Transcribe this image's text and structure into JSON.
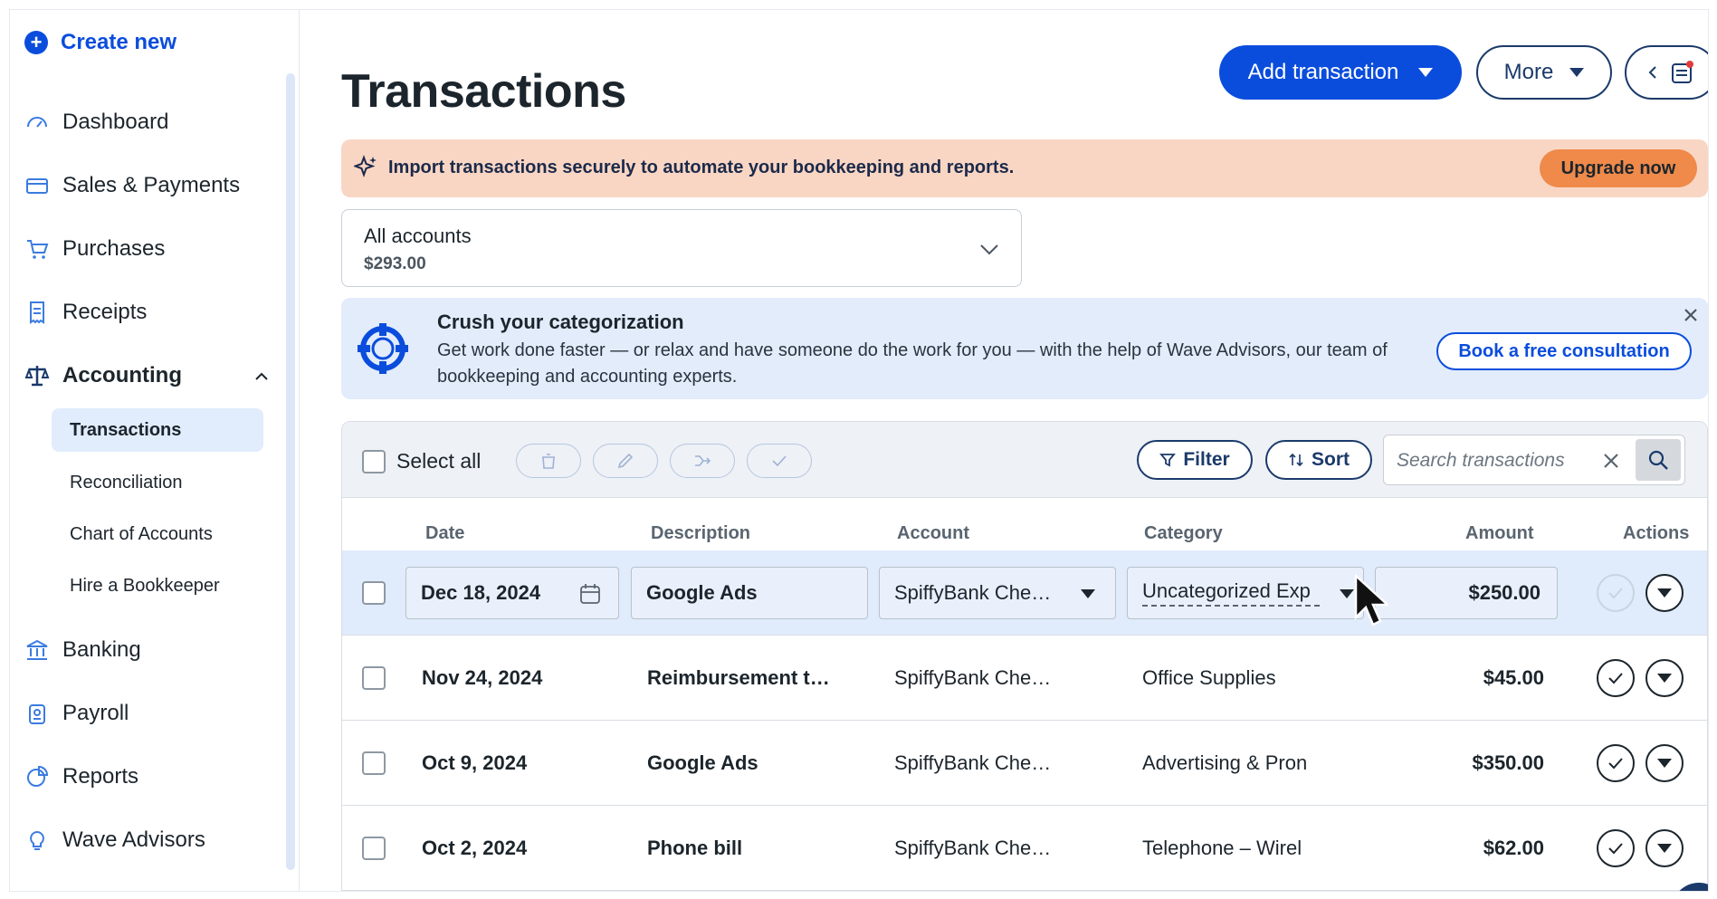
{
  "sidebar": {
    "create_new": "Create new",
    "items": [
      {
        "label": "Dashboard",
        "icon": "gauge-icon"
      },
      {
        "label": "Sales & Payments",
        "icon": "card-icon"
      },
      {
        "label": "Purchases",
        "icon": "cart-icon"
      },
      {
        "label": "Receipts",
        "icon": "receipt-icon"
      },
      {
        "label": "Accounting",
        "icon": "scale-icon"
      },
      {
        "label": "Banking",
        "icon": "bank-icon"
      },
      {
        "label": "Payroll",
        "icon": "badge-icon"
      },
      {
        "label": "Reports",
        "icon": "pie-icon"
      },
      {
        "label": "Wave Advisors",
        "icon": "lightbulb-icon"
      }
    ],
    "sub_items": [
      "Transactions",
      "Reconciliation",
      "Chart of Accounts",
      "Hire a Bookkeeper"
    ]
  },
  "header": {
    "title": "Transactions",
    "add_transaction": "Add transaction",
    "more": "More"
  },
  "promo": {
    "text": "Import transactions securely to automate your bookkeeping and reports.",
    "button": "Upgrade now"
  },
  "account": {
    "name": "All accounts",
    "balance": "$293.00"
  },
  "advisor": {
    "title": "Crush your categorization",
    "body": "Get work done faster — or relax and have someone do the work for you — with the help of Wave Advisors, our team of bookkeeping and accounting experts.",
    "button": "Book a free consultation"
  },
  "toolbar": {
    "select_all": "Select all",
    "filter": "Filter",
    "sort": "Sort",
    "search_placeholder": "Search transactions"
  },
  "table": {
    "headers": [
      "Date",
      "Description",
      "Account",
      "Category",
      "Amount",
      "Actions"
    ],
    "rows": [
      {
        "date": "Dec 18, 2024",
        "description": "Google Ads",
        "account": "SpiffyBank Che…",
        "category": "Uncategorized Exp",
        "amount": "$250.00"
      },
      {
        "date": "Nov 24, 2024",
        "description": "Reimbursement t…",
        "account": "SpiffyBank Che…",
        "category": "Office Supplies",
        "amount": "$45.00"
      },
      {
        "date": "Oct 9, 2024",
        "description": "Google Ads",
        "account": "SpiffyBank Che…",
        "category": "Advertising & Pron",
        "amount": "$350.00"
      },
      {
        "date": "Oct 2, 2024",
        "description": "Phone bill",
        "account": "SpiffyBank Che…",
        "category": "Telephone – Wirel",
        "amount": "$62.00"
      }
    ]
  },
  "colors": {
    "brand_blue": "#0a4ddd",
    "navy": "#1b3a6b",
    "promo_bg": "#f9d6c4",
    "upgrade_orange": "#ef8a4a",
    "advisor_bg": "#e2ecfb",
    "selected_row": "#e0ebfb"
  }
}
